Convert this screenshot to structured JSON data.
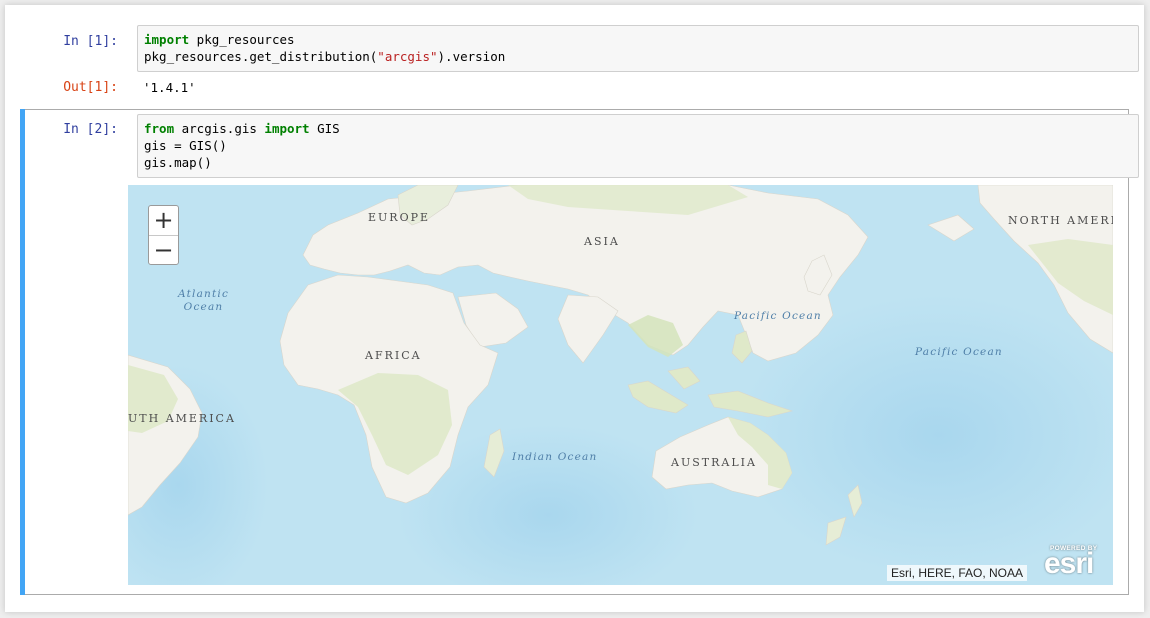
{
  "cells": [
    {
      "prompt": "In [1]:",
      "code_lines": [
        [
          {
            "t": "import",
            "c": "kw"
          },
          {
            "t": " pkg_resources",
            "c": ""
          }
        ],
        [
          {
            "t": "pkg_resources.get_distribution(",
            "c": ""
          },
          {
            "t": "\"arcgis\"",
            "c": "str"
          },
          {
            "t": ").version",
            "c": ""
          }
        ]
      ],
      "out_prompt": "Out[1]:",
      "output": "'1.4.1'"
    },
    {
      "prompt": "In [2]:",
      "code_lines": [
        [
          {
            "t": "from",
            "c": "kw"
          },
          {
            "t": " arcgis.gis ",
            "c": ""
          },
          {
            "t": "import",
            "c": "kw"
          },
          {
            "t": " GIS",
            "c": ""
          }
        ],
        [
          {
            "t": "gis = GIS()",
            "c": ""
          }
        ],
        [
          {
            "t": "gis.map()",
            "c": ""
          }
        ]
      ]
    }
  ],
  "map": {
    "zoom_in_label": "+",
    "zoom_out_label": "−",
    "continent_labels": [
      "EUROPE",
      "ASIA",
      "NORTH AMERIC",
      "AFRICA",
      "UTH AMERICA",
      "AUSTRALIA"
    ],
    "ocean_labels": [
      "Atlantic\nOcean",
      "Pacific Ocean",
      "Pacific Ocean",
      "Indian Ocean"
    ],
    "attribution": "Esri, HERE, FAO, NOAA",
    "logo_powered": "POWERED BY",
    "logo_word": "esri",
    "colors": {
      "ocean": "#bfe3f2",
      "deep_ocean": "#a6d6ef",
      "land": "#f3f2ed",
      "vegetation": "#dfe9c9",
      "accent": "#42a5f5"
    }
  }
}
